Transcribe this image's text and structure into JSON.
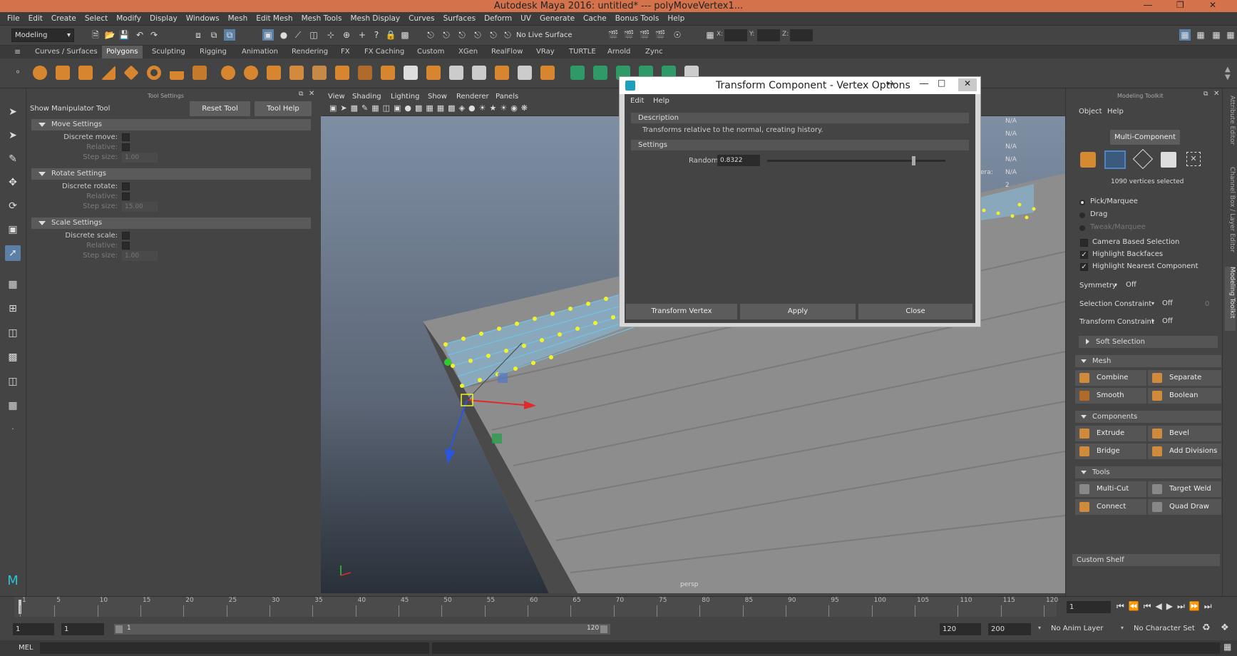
{
  "window": {
    "title": "Autodesk Maya 2016: untitled*   ---   polyMoveVertex1...",
    "controls": [
      "―",
      "❐",
      "✕"
    ]
  },
  "menubar": [
    "File",
    "Edit",
    "Create",
    "Select",
    "Modify",
    "Display",
    "Windows",
    "Mesh",
    "Edit Mesh",
    "Mesh Tools",
    "Mesh Display",
    "Curves",
    "Surfaces",
    "Deform",
    "UV",
    "Generate",
    "Cache",
    "Bonus Tools",
    "Help"
  ],
  "statusline": {
    "mode": "Modeling",
    "live_surface": "No Live Surface",
    "x_label": "X:",
    "y_label": "Y:",
    "z_label": "Z:"
  },
  "shelf_tabs": [
    "Curves / Surfaces",
    "Polygons",
    "Sculpting",
    "Rigging",
    "Animation",
    "Rendering",
    "FX",
    "FX Caching",
    "Custom",
    "XGen",
    "RealFlow",
    "VRay",
    "TURTLE",
    "Arnold",
    "Zync"
  ],
  "active_shelf_tab": "Polygons",
  "tool_settings": {
    "panel_title": "Tool Settings",
    "tool_name": "Show Manipulator Tool",
    "reset_label": "Reset Tool",
    "help_label": "Tool Help",
    "move": {
      "title": "Move Settings",
      "discrete": "Discrete move:",
      "relative": "Relative:",
      "step": "Step size:",
      "step_value": "1.00"
    },
    "rotate": {
      "title": "Rotate Settings",
      "discrete": "Discrete rotate:",
      "relative": "Relative:",
      "step": "Step size:",
      "step_value": "15.00"
    },
    "scale": {
      "title": "Scale Settings",
      "discrete": "Discrete scale:",
      "relative": "Relative:",
      "step": "Step size:",
      "step_value": "1.00"
    }
  },
  "viewport": {
    "menus": [
      "View",
      "Shading",
      "Lighting",
      "Show",
      "Renderer",
      "Panels"
    ],
    "camera": "persp",
    "hud_values": [
      "N/A",
      "N/A",
      "N/A",
      "N/A",
      "N/A",
      "2"
    ],
    "hud_label": "era:"
  },
  "dialog": {
    "title": "Transform Component - Vertex Options",
    "menus": [
      "Edit",
      "Help"
    ],
    "description_header": "Description",
    "description_text": "Transforms relative to the normal, creating history.",
    "settings_header": "Settings",
    "random_label": "Random",
    "random_value": "0.8322",
    "random_fraction": 0.83,
    "buttons": {
      "transform": "Transform Vertex",
      "apply": "Apply",
      "close": "Close"
    }
  },
  "modeling_toolkit": {
    "panel_title": "Modeling Toolkit",
    "menus": [
      "Object",
      "Help"
    ],
    "mode_button": "Multi-Component",
    "selection_count": "1090 vertices selected",
    "pick_marquee": "Pick/Marquee",
    "drag": "Drag",
    "tweak_marquee": "Tweak/Marquee",
    "camera_based": "Camera Based Selection",
    "highlight_backfaces": "Highlight Backfaces",
    "highlight_nearest": "Highlight Nearest Component",
    "symmetry_label": "Symmetry",
    "symmetry_value": "Off",
    "selection_constraint_label": "Selection Constraint",
    "selection_constraint_value": "Off",
    "selection_constraint_num": "0",
    "transform_constraint_label": "Transform Constraint",
    "transform_constraint_value": "Off",
    "soft_selection": "Soft Selection",
    "mesh_header": "Mesh",
    "combine": "Combine",
    "separate": "Separate",
    "smooth": "Smooth",
    "boolean": "Boolean",
    "components_header": "Components",
    "extrude": "Extrude",
    "bevel": "Bevel",
    "bridge": "Bridge",
    "add_divisions": "Add Divisions",
    "tools_header": "Tools",
    "multi_cut": "Multi-Cut",
    "target_weld": "Target Weld",
    "connect": "Connect",
    "quad_draw": "Quad Draw",
    "custom_shelf": "Custom Shelf"
  },
  "right_strip_tabs": [
    "Attribute Editor",
    "Channel Box / Layer Editor",
    "Modeling Toolkit"
  ],
  "timeline": {
    "ticks": [
      "1",
      "5",
      "10",
      "15",
      "20",
      "25",
      "30",
      "35",
      "40",
      "45",
      "50",
      "55",
      "60",
      "65",
      "70",
      "75",
      "80",
      "85",
      "90",
      "95",
      "100",
      "105",
      "110",
      "115",
      "120"
    ],
    "current_frame": "1"
  },
  "range": {
    "start": "1",
    "playback_start": "1",
    "slider_start": "1",
    "slider_end": "120",
    "playback_end": "120",
    "end": "200",
    "anim_layer": "No Anim Layer",
    "char_set": "No Character Set"
  },
  "cmdline": {
    "label": "MEL"
  },
  "colors": {
    "titlebar": "#d4734b",
    "accent": "#5d5d5d",
    "selected_vertex": "#f2f22a",
    "mesh_wire": "#69c8f0"
  }
}
